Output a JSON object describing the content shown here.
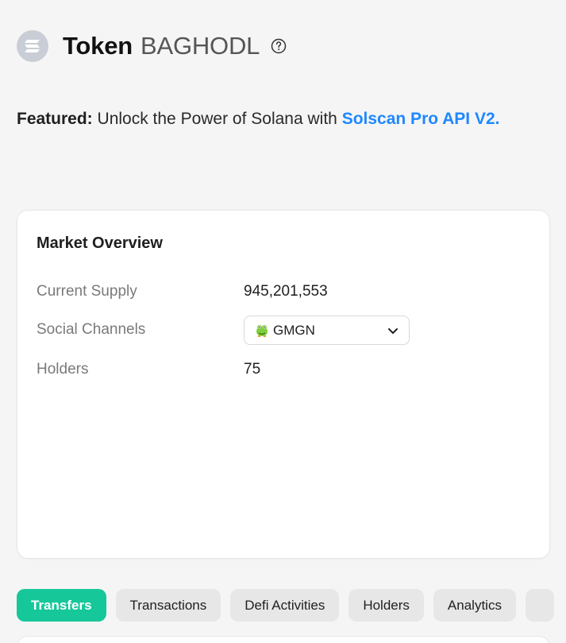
{
  "header": {
    "title_prefix": "Token",
    "title_symbol": "BAGHODL",
    "logo_icon": "solana-logo-icon",
    "help_icon": "question-circle-icon"
  },
  "featured": {
    "label": "Featured:",
    "text": " Unlock the Power of Solana with ",
    "link_text": "Solscan Pro API V2."
  },
  "market_overview": {
    "title": "Market Overview",
    "rows": [
      {
        "label": "Current Supply",
        "value": "945,201,553"
      },
      {
        "label": "Social Channels",
        "value": "GMGN",
        "icon": "gmgn-icon"
      },
      {
        "label": "Holders",
        "value": "75"
      }
    ]
  },
  "tabs": [
    {
      "label": "Transfers",
      "active": true
    },
    {
      "label": "Transactions"
    },
    {
      "label": "Defi Activities"
    },
    {
      "label": "Holders"
    },
    {
      "label": "Analytics"
    },
    {
      "label": ""
    }
  ],
  "colors": {
    "accent": "#16c79a",
    "link": "#1e88ff"
  }
}
